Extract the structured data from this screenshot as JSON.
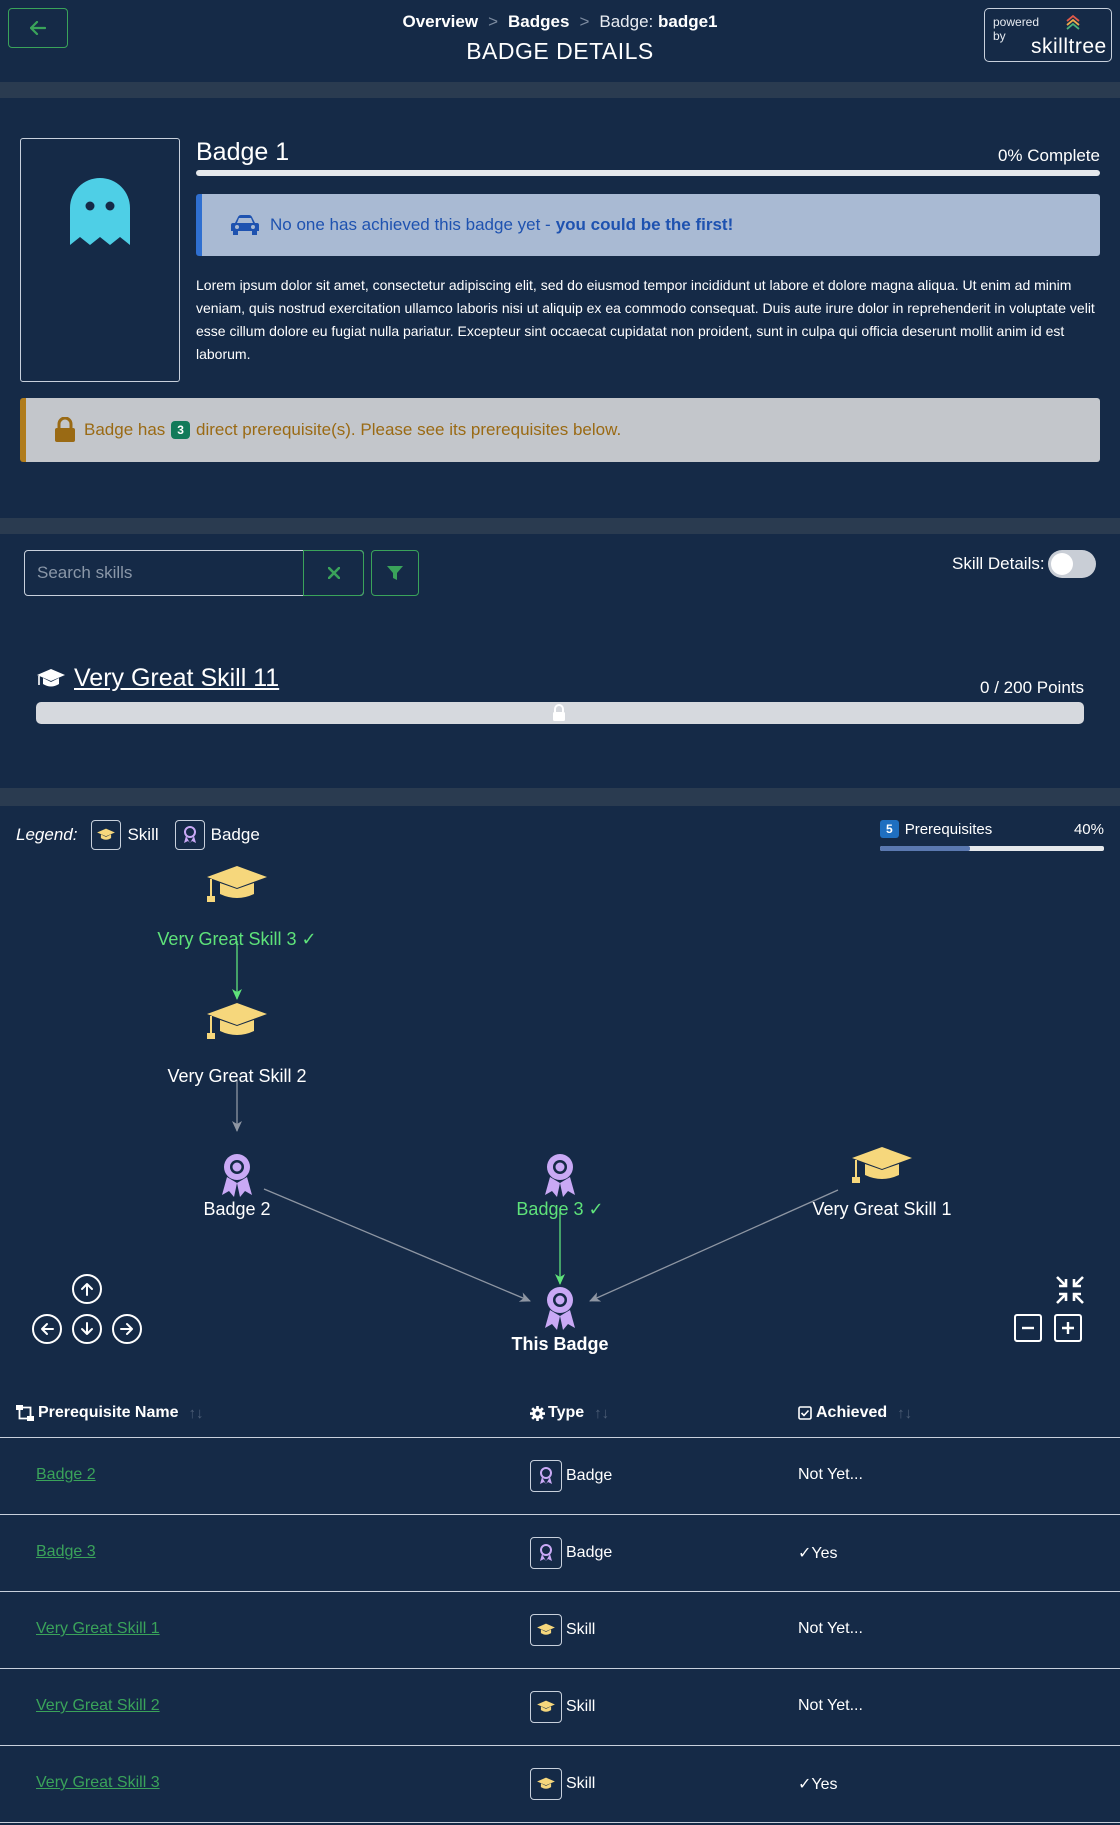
{
  "header": {
    "breadcrumb": [
      "Overview",
      "Badges"
    ],
    "breadcrumb_current_prefix": "Badge: ",
    "breadcrumb_current_id": "badge1",
    "title": "BADGE DETAILS",
    "powered_by_line1": "powered",
    "powered_by_line2": "by",
    "brand": "skilltree"
  },
  "badge": {
    "name": "Badge 1",
    "progress_label": "0% Complete",
    "progress_fraction": 0,
    "achieve_msg": "No one has achieved this badge yet -",
    "achieve_emph": "you could be the first!",
    "description": "Lorem ipsum dolor sit amet, consectetur adipiscing elit, sed do eiusmod tempor incididunt ut labore et dolore magna aliqua. Ut enim ad minim veniam, quis nostrud exercitation ullamco laboris nisi ut aliquip ex ea commodo consequat. Duis aute irure dolor in reprehenderit in voluptate velit esse cillum dolore eu fugiat nulla pariatur. Excepteur sint occaecat cupidatat non proident, sunt in culpa qui officia deserunt mollit anim id est laborum.",
    "prereq_msg_before": "Badge has",
    "prereq_count": "3",
    "prereq_msg_after": "direct prerequisite(s). Please see its prerequisites below."
  },
  "skills": {
    "search_placeholder": "Search skills",
    "details_label": "Skill Details:",
    "details_on": false,
    "skill_name": "Very Great Skill 11",
    "skill_points": "0 / 200 Points",
    "skill_progress_fraction": 0
  },
  "graph": {
    "legend_label": "Legend:",
    "legend_skill": "Skill",
    "legend_badge": "Badge",
    "prereq_count": "5",
    "prereq_label": "Prerequisites",
    "prereq_pct": "40%",
    "prereq_fraction": 0.4,
    "nodes": {
      "skill3": "Very Great Skill 3 ✓",
      "skill2": "Very Great Skill 2",
      "badge2": "Badge 2",
      "badge3": "Badge 3 ✓",
      "skill1": "Very Great Skill 1",
      "this": "This Badge"
    },
    "colors": {
      "achieved": "#5ee27a",
      "skill_icon": "#f6d77c",
      "badge_icon": "#c9a9f5",
      "edge": "#8e96a3"
    }
  },
  "table": {
    "headers": {
      "name": "Prerequisite Name",
      "type": "Type",
      "achieved": "Achieved"
    },
    "rows": [
      {
        "name": "Badge 2",
        "type": "Badge",
        "achieved": "Not Yet..."
      },
      {
        "name": "Badge 3",
        "type": "Badge",
        "achieved": "✓Yes"
      },
      {
        "name": "Very Great Skill 1",
        "type": "Skill",
        "achieved": "Not Yet..."
      },
      {
        "name": "Very Great Skill 2",
        "type": "Skill",
        "achieved": "Not Yet..."
      },
      {
        "name": "Very Great Skill 3",
        "type": "Skill",
        "achieved": "✓Yes"
      }
    ]
  }
}
